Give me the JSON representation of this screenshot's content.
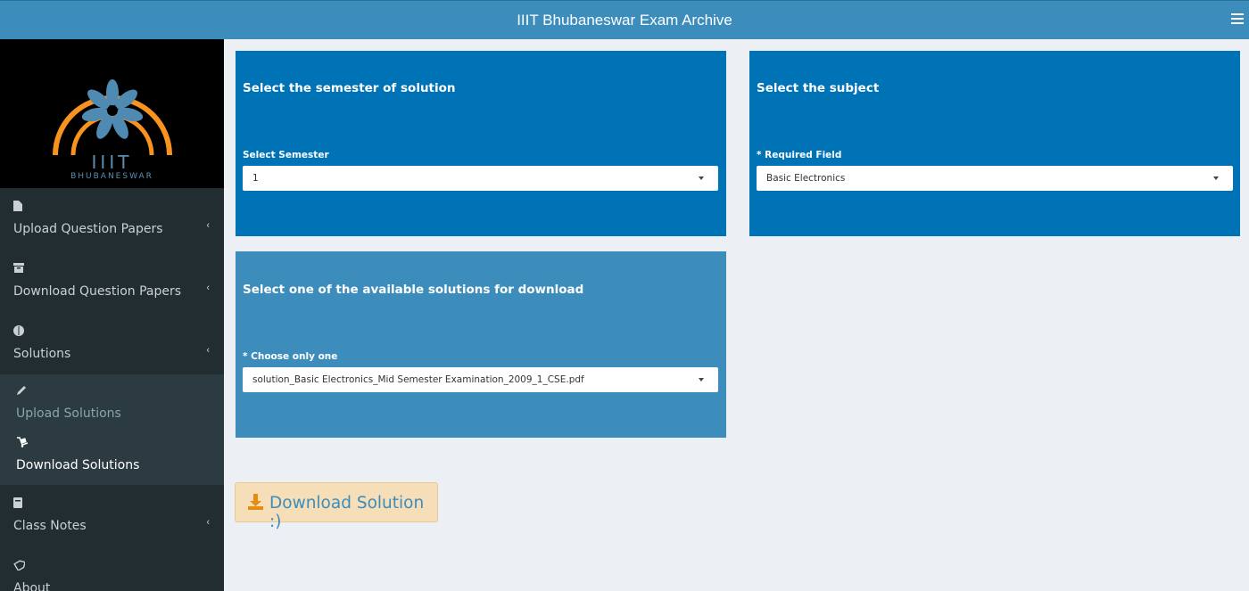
{
  "header": {
    "title": "IIIT Bhubaneswar Exam Archive",
    "menu_icon": "hamburger-icon"
  },
  "logo": {
    "text": "IIIT",
    "subtext": "BHUBANESWAR"
  },
  "sidebar": {
    "items": [
      {
        "label": "Upload Question Papers",
        "icon": "file-icon"
      },
      {
        "label": "Download Question Papers",
        "icon": "archive-icon"
      },
      {
        "label": "Solutions",
        "icon": "brain-icon"
      },
      {
        "label": "Class Notes",
        "icon": "book-icon"
      },
      {
        "label": "About",
        "icon": "tag-icon"
      }
    ],
    "subitems": [
      {
        "label": "Upload Solutions",
        "icon": "pencil-icon"
      },
      {
        "label": "Download Solutions",
        "icon": "dolly-icon"
      }
    ]
  },
  "semester_panel": {
    "title": "Select the semester of solution",
    "label": "Select Semester",
    "selected": "1"
  },
  "subject_panel": {
    "title": "Select the subject",
    "label": "* Required Field",
    "selected": "Basic Electronics"
  },
  "solutions_panel": {
    "title": "Select one of the available solutions for download",
    "label": "* Choose only one",
    "selected": "solution_Basic Electronics_Mid Semester Examination_2009_1_CSE.pdf"
  },
  "download_button": {
    "label": "Download Solution :)",
    "icon": "download-icon"
  },
  "colors": {
    "header": "#3c8dbc",
    "sidebar": "#222d32",
    "panel_primary": "#0073b7",
    "panel_light": "#3c8dbc",
    "button_bg": "#f6deb8",
    "logo_orange": "#f7931e"
  }
}
